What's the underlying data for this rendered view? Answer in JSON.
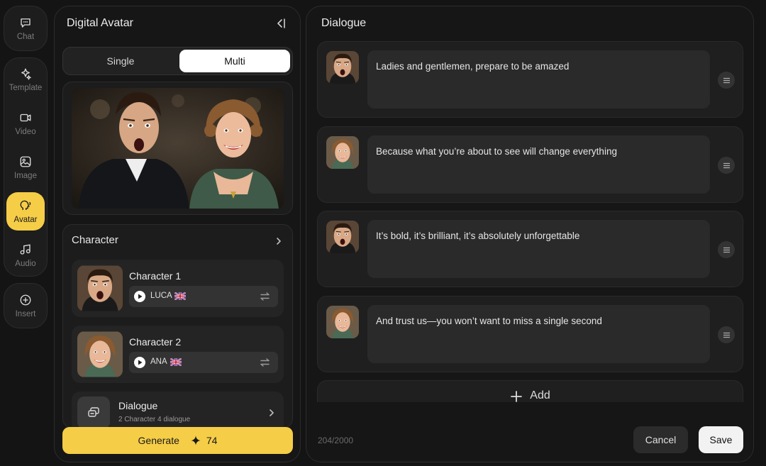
{
  "rail": {
    "items": [
      {
        "label": "Chat",
        "icon": "chat-icon"
      },
      {
        "label": "Template",
        "icon": "sparkle-template-icon"
      },
      {
        "label": "Video",
        "icon": "video-camera-icon"
      },
      {
        "label": "Image",
        "icon": "image-icon"
      },
      {
        "label": "Avatar",
        "icon": "avatar-head-icon",
        "active": true
      },
      {
        "label": "Audio",
        "icon": "music-note-icon"
      },
      {
        "label": "Insert",
        "icon": "plus-circle-icon"
      }
    ]
  },
  "left_panel": {
    "title": "Digital Avatar",
    "tabs": [
      {
        "label": "Single",
        "active": false
      },
      {
        "label": "Multi",
        "active": true
      }
    ],
    "character_section": {
      "title": "Character",
      "characters": [
        {
          "name": "Character 1",
          "voice": "LUCA",
          "flag": "uk-flag"
        },
        {
          "name": "Character 2",
          "voice": "ANA",
          "flag": "uk-flag"
        }
      ]
    },
    "dialogue": {
      "title": "Dialogue",
      "subtitle": "2 Character 4 dialogue"
    },
    "generate": {
      "label": "Generate",
      "cost": "74"
    }
  },
  "right_panel": {
    "title": "Dialogue",
    "lines": [
      {
        "speaker": "Character 1",
        "text": "Ladies and gentlemen, prepare to be amazed"
      },
      {
        "speaker": "Character 2",
        "text": "Because what you’re about to see will change everything"
      },
      {
        "speaker": "Character 1",
        "text": "It’s bold, it’s brilliant, it’s absolutely unforgettable"
      },
      {
        "speaker": "Character 2",
        "text": "And trust us—you won’t want to miss a single second"
      }
    ],
    "add_label": "Add",
    "counter": "204/2000",
    "cancel_label": "Cancel",
    "save_label": "Save"
  },
  "colors": {
    "accent": "#f5cd47",
    "background": "#141414",
    "panel": "#161616"
  }
}
